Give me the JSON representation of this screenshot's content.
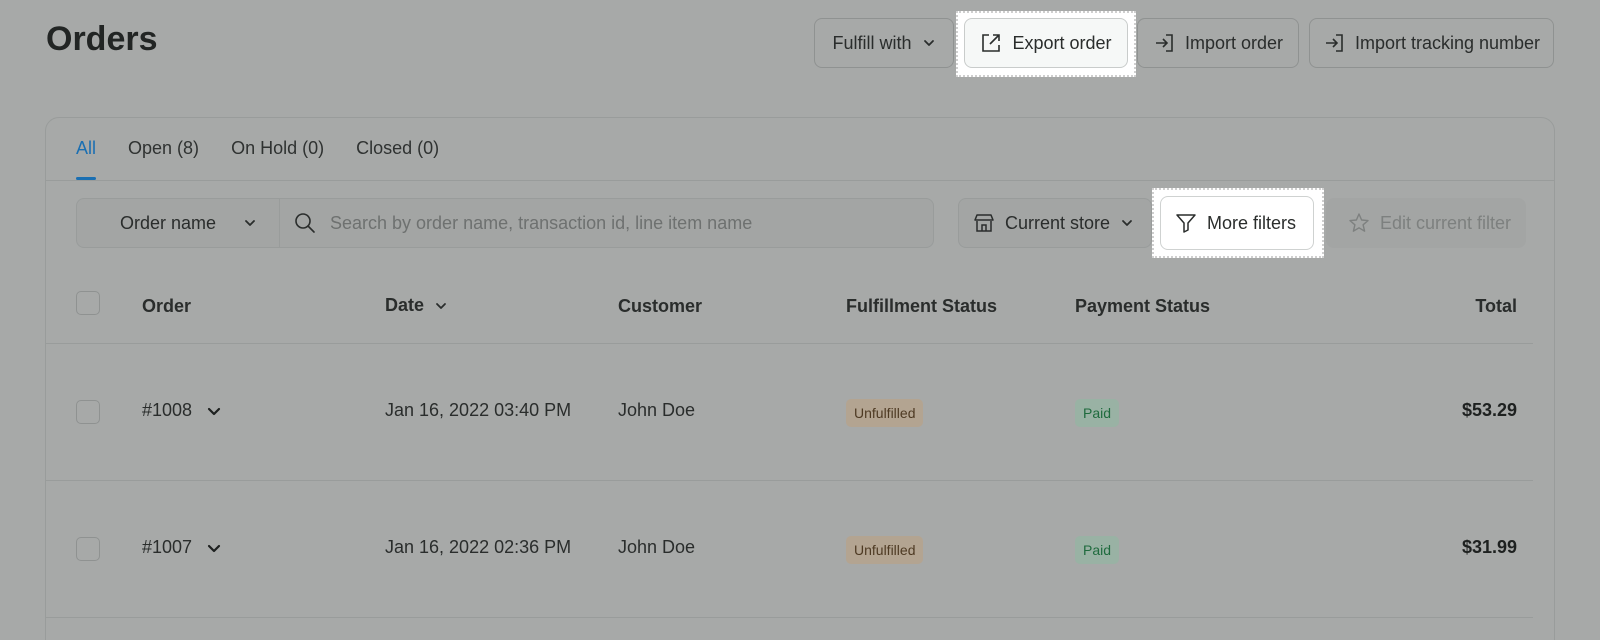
{
  "header": {
    "title": "Orders"
  },
  "actions": {
    "fulfill_with": "Fulfill with",
    "export_order": "Export order",
    "import_order": "Import order",
    "import_tracking": "Import tracking number"
  },
  "tabs": [
    {
      "label": "All",
      "active": true
    },
    {
      "label": "Open (8)",
      "active": false
    },
    {
      "label": "On Hold (0)",
      "active": false
    },
    {
      "label": "Closed (0)",
      "active": false
    }
  ],
  "filters": {
    "order_name_select": "Order name",
    "search_placeholder": "Search by order name, transaction id, line item name",
    "current_store": "Current store",
    "more_filters": "More filters",
    "edit_current_filter": "Edit current filter"
  },
  "table": {
    "columns": {
      "order": "Order",
      "date": "Date",
      "customer": "Customer",
      "fulfillment": "Fulfillment Status",
      "payment": "Payment Status",
      "total": "Total"
    },
    "rows": [
      {
        "order": "#1008",
        "date": "Jan 16, 2022 03:40 PM",
        "customer": "John Doe",
        "fulfillment": "Unfulfilled",
        "payment": "Paid",
        "total": "$53.29"
      },
      {
        "order": "#1007",
        "date": "Jan 16, 2022 02:36 PM",
        "customer": "John Doe",
        "fulfillment": "Unfulfilled",
        "payment": "Paid",
        "total": "$31.99"
      }
    ]
  },
  "colors": {
    "accent": "#1a6fb2",
    "paid_text": "#1f6b3e",
    "unfulfilled_text": "#4e3a23"
  },
  "icons": [
    "chevron-down-icon",
    "export-icon",
    "import-icon",
    "search-icon",
    "store-icon",
    "filter-icon",
    "star-icon"
  ]
}
